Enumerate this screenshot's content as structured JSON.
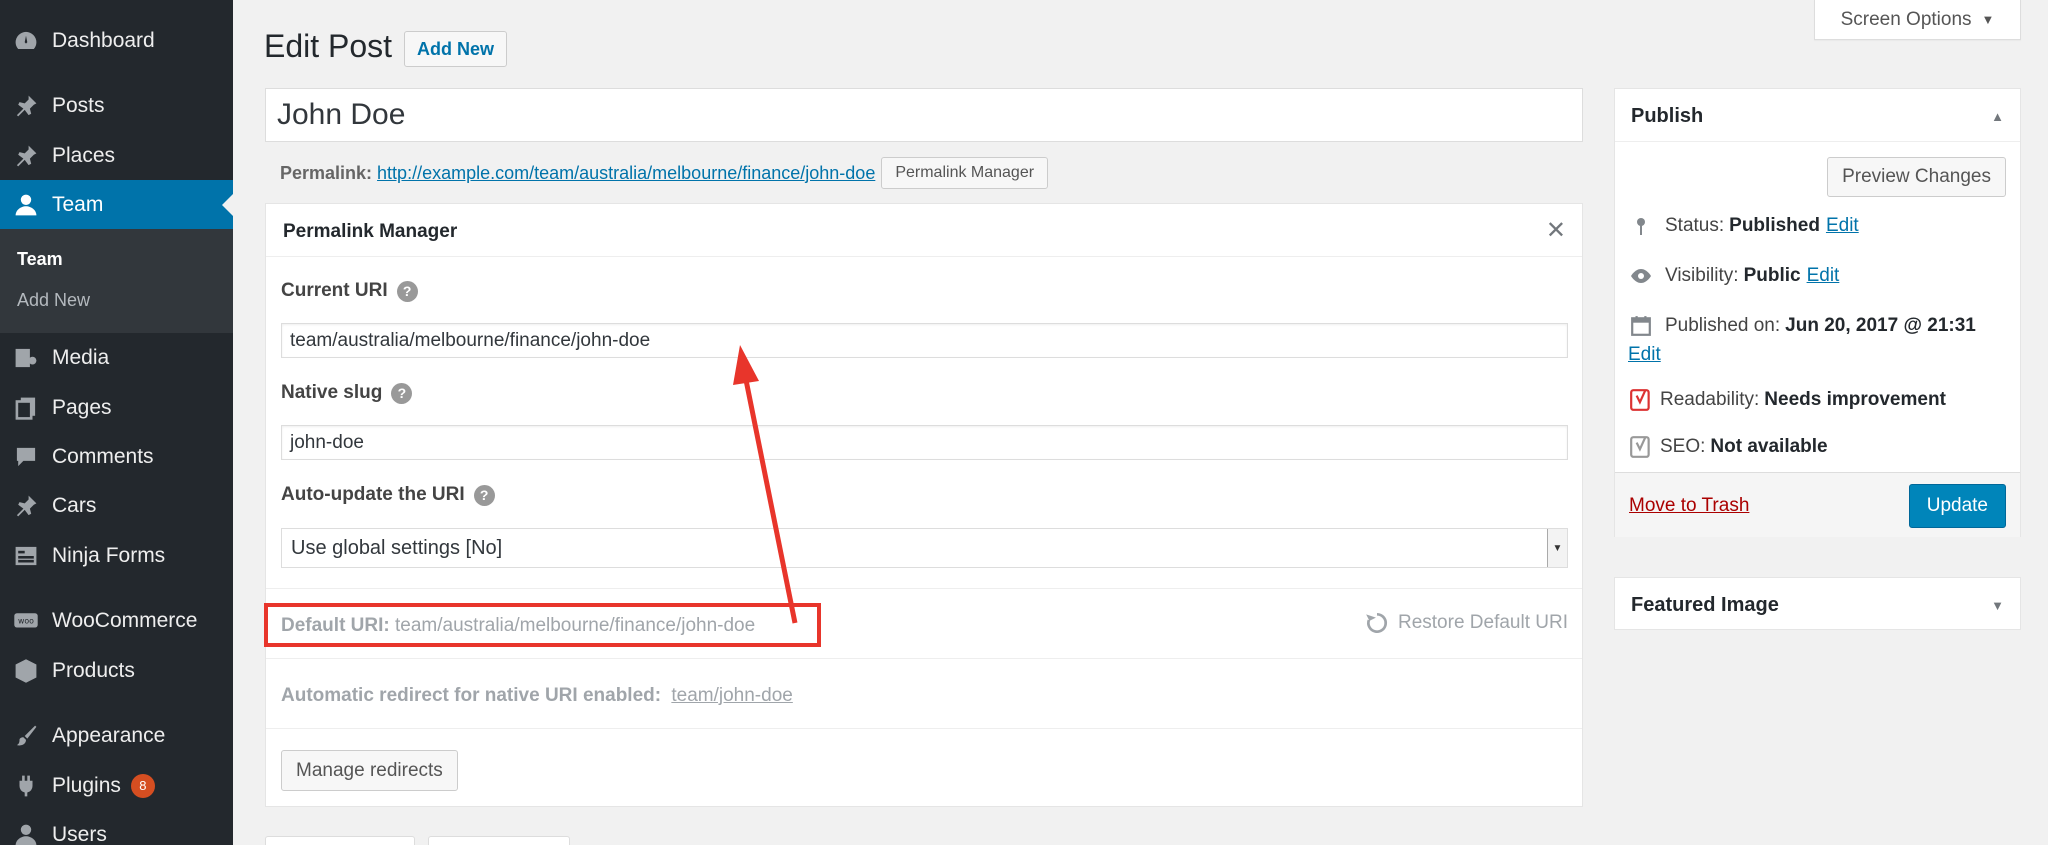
{
  "sidebar": {
    "items": [
      {
        "label": "Dashboard",
        "icon": "dashboard-icon"
      },
      {
        "label": "Posts",
        "icon": "pin-icon"
      },
      {
        "label": "Places",
        "icon": "pin-icon"
      },
      {
        "label": "Team",
        "icon": "user-icon",
        "active": true
      },
      {
        "label": "Media",
        "icon": "media-icon"
      },
      {
        "label": "Pages",
        "icon": "pages-icon"
      },
      {
        "label": "Comments",
        "icon": "comment-icon"
      },
      {
        "label": "Cars",
        "icon": "pin-icon"
      },
      {
        "label": "Ninja Forms",
        "icon": "forms-icon"
      },
      {
        "label": "WooCommerce",
        "icon": "woocommerce-icon"
      },
      {
        "label": "Products",
        "icon": "box-icon"
      },
      {
        "label": "Appearance",
        "icon": "brush-icon"
      },
      {
        "label": "Plugins",
        "icon": "plugin-icon",
        "badge": "8"
      },
      {
        "label": "Users",
        "icon": "users-icon"
      }
    ],
    "submenu": [
      {
        "label": "Team"
      },
      {
        "label": "Add New"
      }
    ]
  },
  "header": {
    "screen_options": "Screen Options",
    "page_title": "Edit Post",
    "add_new": "Add New"
  },
  "post": {
    "title": "John Doe",
    "permalink_label": "Permalink:",
    "permalink_url": "http://example.com/team/australia/melbourne/finance/john-doe",
    "permalink_button": "Permalink Manager"
  },
  "permalink_manager": {
    "title": "Permalink Manager",
    "close": "✕",
    "current_uri_label": "Current URI",
    "current_uri_value": "team/australia/melbourne/finance/john-doe",
    "native_slug_label": "Native slug",
    "native_slug_value": "john-doe",
    "auto_update_label": "Auto-update the URI",
    "auto_update_value": "Use global settings [No]",
    "default_uri_label": "Default URI:",
    "default_uri_value": "team/australia/melbourne/finance/john-doe",
    "restore_label": "Restore Default URI",
    "redirect_label": "Automatic redirect for native URI enabled:",
    "redirect_value": "team/john-doe",
    "manage_redirects": "Manage redirects"
  },
  "publish": {
    "title": "Publish",
    "preview_changes": "Preview Changes",
    "status_label": "Status:",
    "status_value": "Published",
    "visibility_label": "Visibility:",
    "visibility_value": "Public",
    "published_on_label": "Published on:",
    "published_on_value": "Jun 20, 2017 @ 21:31",
    "edit": "Edit",
    "readability_label": "Readability:",
    "readability_value": "Needs improvement",
    "seo_label": "SEO:",
    "seo_value": "Not available",
    "move_to_trash": "Move to Trash",
    "update": "Update"
  },
  "featured_image": {
    "title": "Featured Image"
  },
  "colors": {
    "accent": "#0073aa",
    "sidebar": "#23282d",
    "annotation": "#e8352b",
    "trash": "#a00000"
  }
}
